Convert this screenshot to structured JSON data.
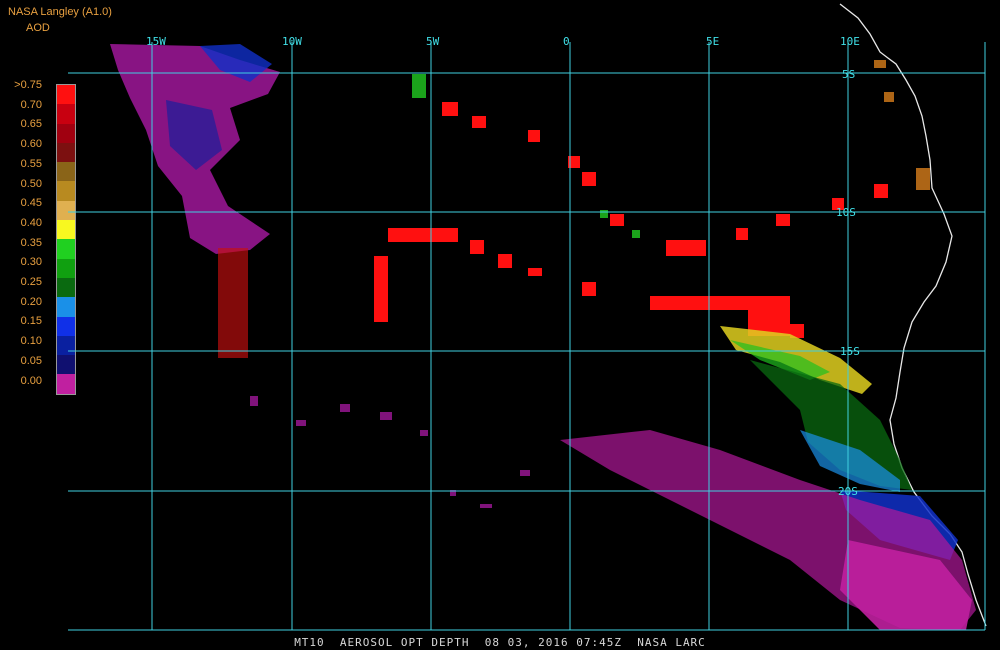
{
  "header": {
    "title": "NASA Langley (A1.0)",
    "unit": "AOD"
  },
  "legend": {
    "labels": [
      ">0.75",
      "0.70",
      "0.65",
      "0.60",
      "0.55",
      "0.50",
      "0.45",
      "0.40",
      "0.35",
      "0.30",
      "0.25",
      "0.20",
      "0.15",
      "0.10",
      "0.05",
      "0.00"
    ],
    "colors": [
      "#ff1010",
      "#c80010",
      "#a00010",
      "#7c1010",
      "#8a6418",
      "#b88a20",
      "#e0b050",
      "#f8f820",
      "#20d020",
      "#10a010",
      "#0a6a10",
      "#1a90e8",
      "#1030e8",
      "#0a20a0",
      "#101070",
      "#c020a0"
    ]
  },
  "axes": {
    "lon_labels": [
      "15W",
      "10W",
      "5W",
      "0",
      "5E",
      "10E"
    ],
    "lat_labels": [
      "5S",
      "10S",
      "15S",
      "20S"
    ]
  },
  "footer": "MT10  AEROSOL OPT DEPTH  08 03, 2016 07:45Z  NASA LARC"
}
